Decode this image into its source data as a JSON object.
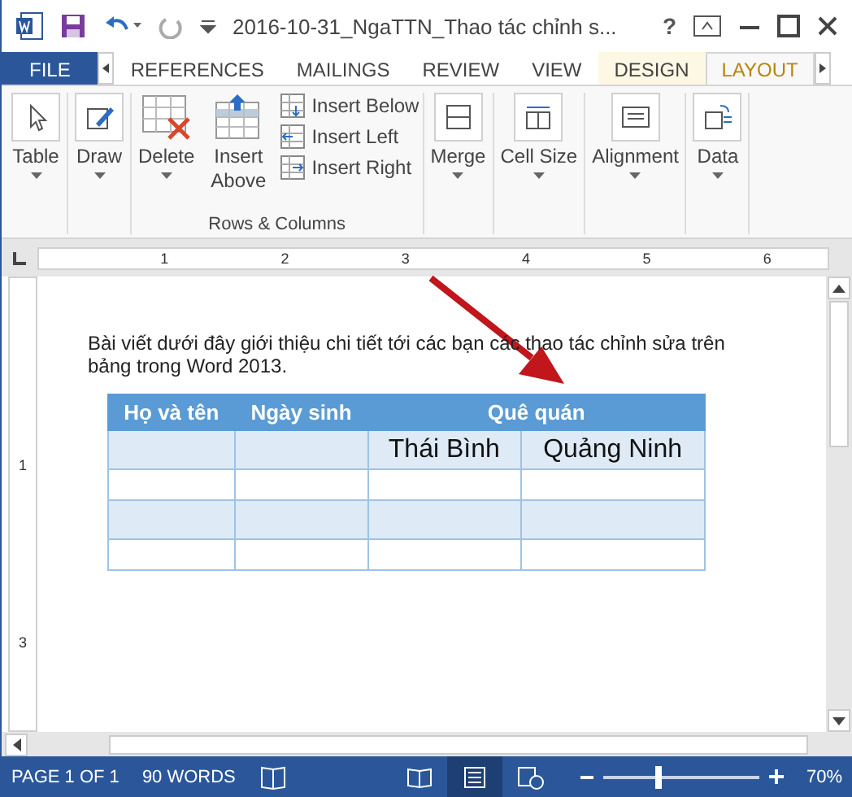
{
  "title_bar": {
    "title": "2016-10-31_NgaTTN_Thao tác chỉnh s...",
    "help": "?"
  },
  "tabs": [
    {
      "label": "FILE",
      "kind": "file",
      "selected": false
    },
    {
      "label": "REFERENCES",
      "kind": "normal",
      "selected": false
    },
    {
      "label": "MAILINGS",
      "kind": "normal",
      "selected": false
    },
    {
      "label": "REVIEW",
      "kind": "normal",
      "selected": false
    },
    {
      "label": "VIEW",
      "kind": "normal",
      "selected": false
    },
    {
      "label": "DESIGN",
      "kind": "contextual",
      "selected": false
    },
    {
      "label": "LAYOUT",
      "kind": "contextual",
      "selected": true
    }
  ],
  "ribbon": {
    "left_buttons": [
      {
        "label": "Table",
        "kind": "select"
      },
      {
        "label": "Draw",
        "kind": "draw"
      }
    ],
    "rows_columns": {
      "label": "Rows & Columns",
      "delete": "Delete",
      "insert_above": "Insert Above",
      "small": [
        {
          "label": "Insert Below",
          "kind": "below"
        },
        {
          "label": "Insert Left",
          "kind": "left"
        },
        {
          "label": "Insert Right",
          "kind": "right"
        }
      ]
    },
    "right_buttons": [
      {
        "label": "Merge",
        "kind": "merge"
      },
      {
        "label": "Cell Size",
        "kind": "size"
      },
      {
        "label": "Alignment",
        "kind": "align"
      },
      {
        "label": "Data",
        "kind": "data"
      }
    ]
  },
  "ruler": {
    "marks": [
      "1",
      "2",
      "3",
      "4",
      "5",
      "6"
    ]
  },
  "vertical_ruler": {
    "marks": [
      "1",
      "3"
    ]
  },
  "document": {
    "paragraph": "Bài viết dưới đây giới thiệu chi tiết tới các bạn các thao tác chỉnh sửa trên bảng trong Word 2013.",
    "table": {
      "header": [
        {
          "text": "Họ và tên",
          "kind": "single"
        },
        {
          "text": "Ngày sinh",
          "kind": "single"
        },
        {
          "text": "Quê quán",
          "kind": "group"
        }
      ],
      "rows": [
        [
          null,
          null,
          "Thái Bình",
          "Quảng Ninh"
        ],
        [
          null,
          null,
          null,
          null
        ],
        [
          null,
          null,
          null,
          null
        ],
        [
          null,
          null,
          null,
          null
        ]
      ]
    }
  },
  "status_bar": {
    "page": "PAGE 1 OF 1",
    "words": "90 WORDS",
    "views": [
      {
        "kind": "read",
        "selected": false
      },
      {
        "kind": "print",
        "selected": true
      },
      {
        "kind": "web",
        "selected": false
      }
    ],
    "zoom": {
      "level": 0.35,
      "reading": "70%"
    }
  }
}
